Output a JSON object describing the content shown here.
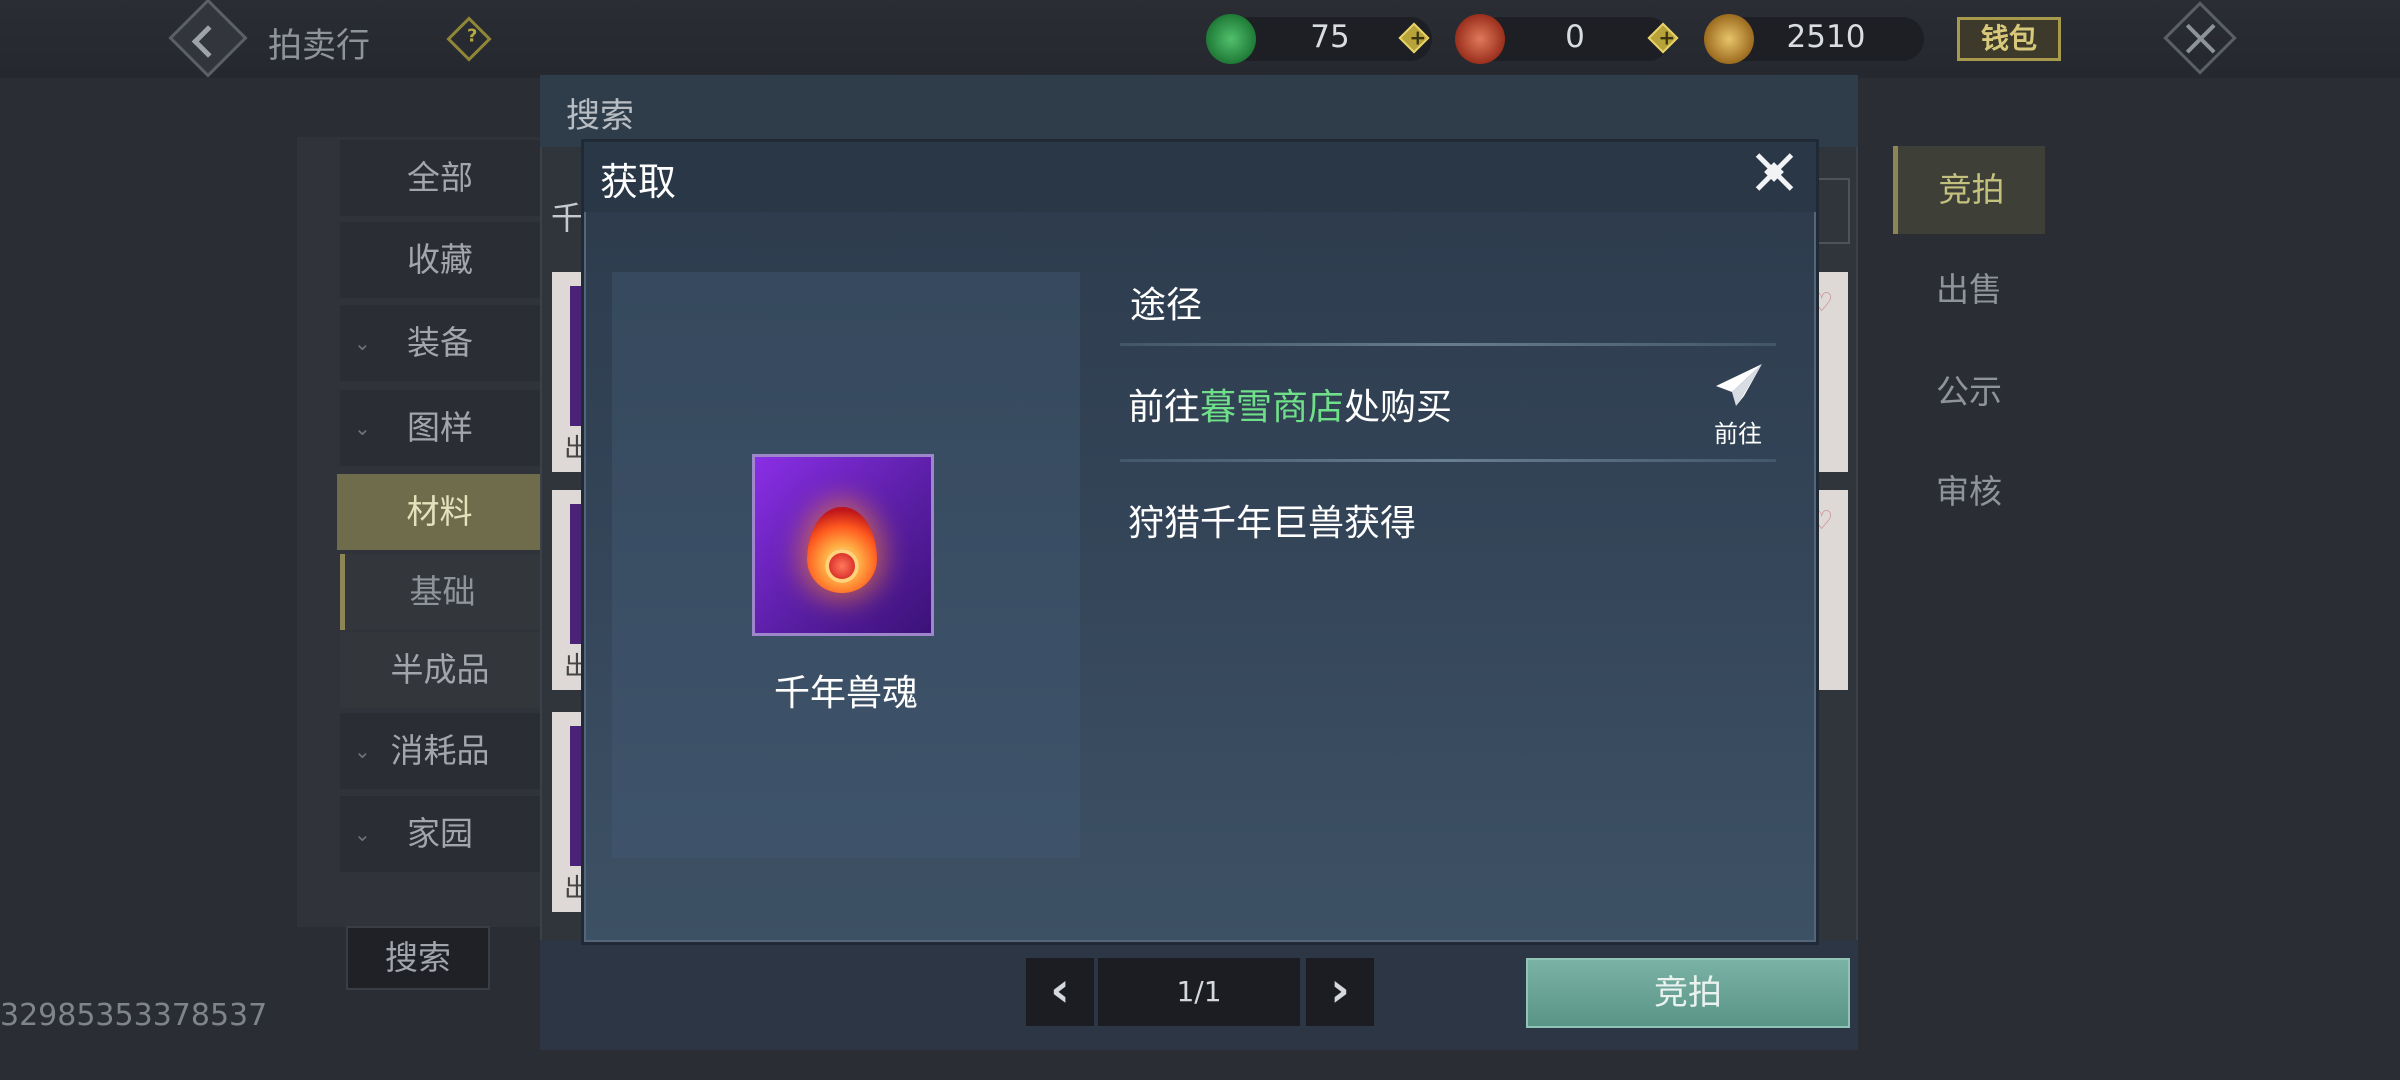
{
  "topbar": {
    "title": "拍卖行",
    "currencies": [
      {
        "name": "jade-currency",
        "value": "75",
        "color": "#2f9a4a"
      },
      {
        "name": "copper-currency",
        "value": "0",
        "color": "#b5432b"
      },
      {
        "name": "gold-currency",
        "value": "2510",
        "color": "#c79a3a"
      }
    ],
    "wallet_label": "钱包"
  },
  "menu": {
    "items": [
      "全部",
      "收藏",
      "装备",
      "图样",
      "材料",
      "基础",
      "半成品",
      "消耗品",
      "家园"
    ],
    "active": "材料",
    "search_label": "搜索"
  },
  "account_id": "32985353378537",
  "center": {
    "header_label": "搜索",
    "search_fragment": "千",
    "card_out_label": "出",
    "page": "1/1",
    "bid_label": "竞拍"
  },
  "right_tabs": [
    "竞拍",
    "出售",
    "公示",
    "审核"
  ],
  "dialog": {
    "title": "获取",
    "item_name": "千年兽魂",
    "route_header": "途径",
    "routes": [
      {
        "prefix": "前往",
        "highlight": "暮雪商店",
        "suffix": "处购买",
        "action": "前往"
      },
      {
        "text": "狩猎千年巨兽获得"
      }
    ]
  }
}
